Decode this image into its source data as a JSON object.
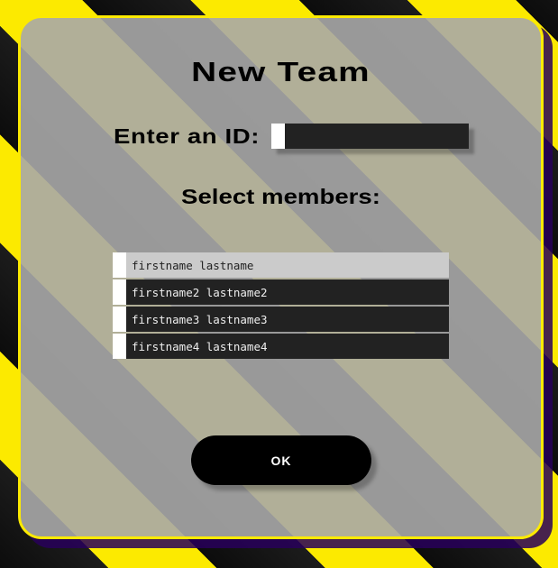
{
  "title": "New Team",
  "id_field": {
    "label": "Enter an ID:",
    "value": "",
    "placeholder": ""
  },
  "members": {
    "label": "Select members:",
    "items": [
      {
        "name": "firstname lastname",
        "selected": true
      },
      {
        "name": "firstname2 lastname2",
        "selected": false
      },
      {
        "name": "firstname3 lastname3",
        "selected": false
      },
      {
        "name": "firstname4 lastname4",
        "selected": false
      }
    ]
  },
  "ok_label": "OK",
  "colors": {
    "stripe_yellow": "#fcea00",
    "stripe_black": "#111111",
    "panel": "#a8a8a8",
    "row_dark": "#222222",
    "row_selected": "#cbcbcb"
  }
}
